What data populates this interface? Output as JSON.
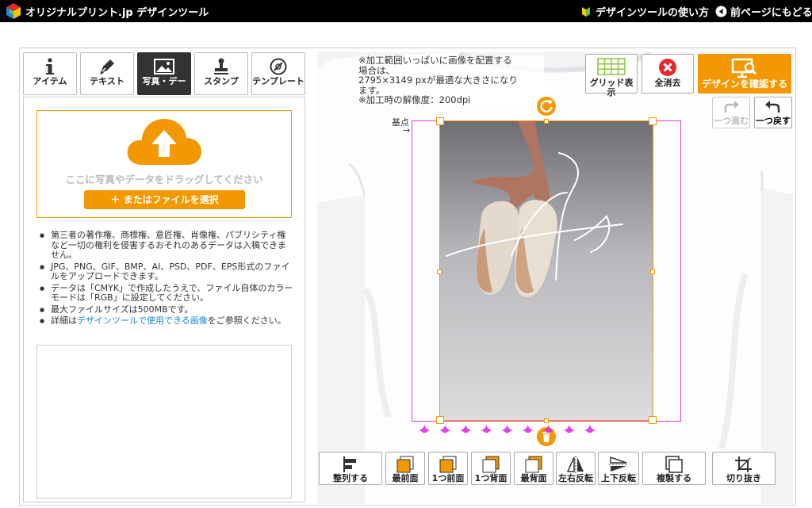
{
  "header": {
    "logo_text": "オリジナルプリント.jp デザインツール",
    "help_link": "デザインツールの使い方",
    "back_link": "前ページにもどる"
  },
  "tabs": [
    {
      "label": "アイテム",
      "icon": "info-icon"
    },
    {
      "label": "テキスト",
      "icon": "pen-icon"
    },
    {
      "label": "写真・デー",
      "icon": "image-icon",
      "active": true
    },
    {
      "label": "スタンプ",
      "icon": "stamp-icon"
    },
    {
      "label": "テンプレート",
      "icon": "template-icon"
    }
  ],
  "upload": {
    "drop_text": "ここに写真やデータをドラッグしてください",
    "select_button": "＋ またはファイルを選択"
  },
  "notes": {
    "n1": "第三者の著作権、商標権、意匠権、肖像権、パブリシティ権など一切の権利を侵害するおそれのあるデータは入稿できません。",
    "n2": "JPG、PNG、GIF、BMP、AI、PSD、PDF、EPS形式のファイルをアップロードできます。",
    "n3": "データは「CMYK」で作成したうえで、ファイル自体のカラーモードは「RGB」に設定してください。",
    "n4": "最大ファイルサイズは500MBです。",
    "n5_pre": "詳細は",
    "n5_link": "デザインツールで使用できる画像",
    "n5_post": "をご参照ください。"
  },
  "info": {
    "line1": "※加工範囲いっぱいに画像を配置する",
    "line2": "場合は、",
    "line3": "2795×3149 pxが最適な大きさになり",
    "line4": "ます。",
    "line5": "※加工時の解像度：200dpi"
  },
  "toolbar": {
    "grid_label": "グリッド表示",
    "clear_label": "全消去",
    "confirm_label": "デザインを確認する",
    "redo_label": "一つ進む",
    "undo_label": "一つ戻す"
  },
  "canvas": {
    "base_point_label": "基点"
  },
  "bottom_bar": [
    {
      "label": "整列する",
      "icon": "align-icon"
    },
    {
      "label": "最前面",
      "icon": "front-icon"
    },
    {
      "label": "1つ前面",
      "icon": "forward-icon"
    },
    {
      "label": "1つ背面",
      "icon": "backward-icon"
    },
    {
      "label": "最背面",
      "icon": "back-icon"
    },
    {
      "label": "左右反転",
      "icon": "flip-horizontal-icon"
    },
    {
      "label": "上下反転",
      "icon": "flip-vertical-icon"
    },
    {
      "label": "複製する",
      "icon": "duplicate-icon"
    },
    {
      "label": "切り抜き",
      "icon": "crop-icon"
    }
  ],
  "colors": {
    "accent": "#f39800",
    "selection": "#e040e0",
    "link": "#1a8ad8",
    "clear_red": "#e8262d"
  }
}
